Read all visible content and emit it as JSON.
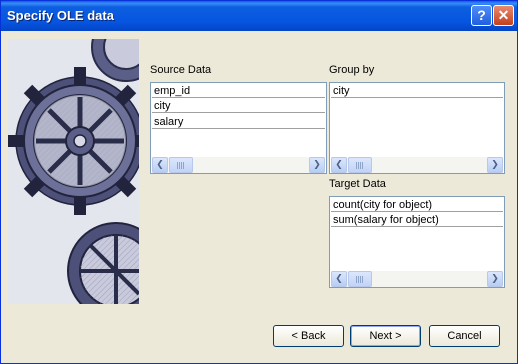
{
  "window": {
    "title": "Specify OLE data",
    "help_glyph": "?",
    "close_glyph": "✕"
  },
  "source": {
    "label": "Source Data",
    "items": [
      "emp_id",
      "city",
      "salary"
    ]
  },
  "groupby": {
    "label": "Group by",
    "items": [
      "city"
    ]
  },
  "target": {
    "label": "Target Data",
    "items": [
      "count(city for object)",
      "sum(salary for object)"
    ]
  },
  "scroll": {
    "left_glyph": "❮",
    "right_glyph": "❯"
  },
  "buttons": {
    "back": "< Back",
    "next": "Next >",
    "cancel": "Cancel"
  }
}
